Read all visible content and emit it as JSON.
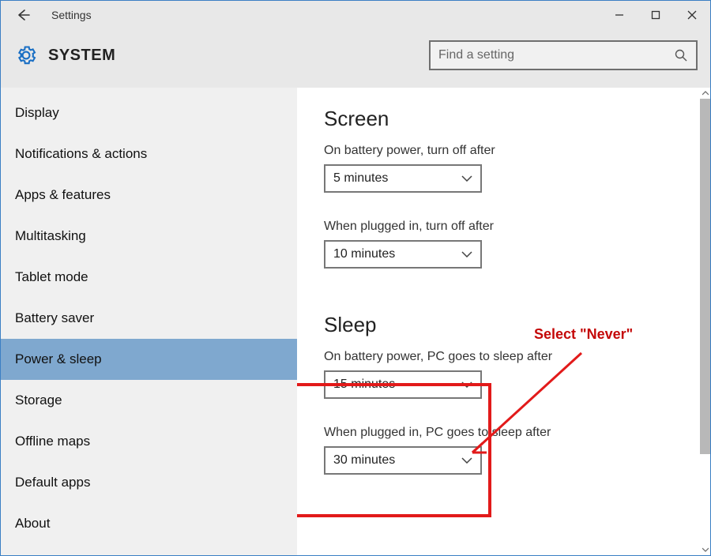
{
  "titlebar": {
    "app_title": "Settings"
  },
  "header": {
    "category": "SYSTEM"
  },
  "search": {
    "placeholder": "Find a setting"
  },
  "sidebar": {
    "items": [
      {
        "label": "Display",
        "selected": false
      },
      {
        "label": "Notifications & actions",
        "selected": false
      },
      {
        "label": "Apps & features",
        "selected": false
      },
      {
        "label": "Multitasking",
        "selected": false
      },
      {
        "label": "Tablet mode",
        "selected": false
      },
      {
        "label": "Battery saver",
        "selected": false
      },
      {
        "label": "Power & sleep",
        "selected": true
      },
      {
        "label": "Storage",
        "selected": false
      },
      {
        "label": "Offline maps",
        "selected": false
      },
      {
        "label": "Default apps",
        "selected": false
      },
      {
        "label": "About",
        "selected": false
      }
    ]
  },
  "content": {
    "screen": {
      "heading": "Screen",
      "battery_label": "On battery power, turn off after",
      "battery_value": "5 minutes",
      "plugged_label": "When plugged in, turn off after",
      "plugged_value": "10 minutes"
    },
    "sleep": {
      "heading": "Sleep",
      "battery_label": "On battery power, PC goes to sleep after",
      "battery_value": "15 minutes",
      "plugged_label": "When plugged in, PC goes to sleep after",
      "plugged_value": "30 minutes"
    }
  },
  "annotation": {
    "text": "Select \"Never\""
  }
}
